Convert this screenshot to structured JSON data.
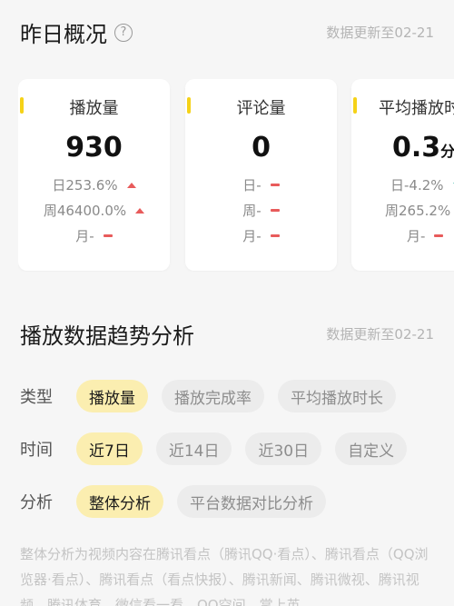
{
  "overview": {
    "title": "昨日概况",
    "help_icon": "?",
    "update_text": "数据更新至02-21",
    "cards": [
      {
        "label": "播放量",
        "value": "930",
        "unit": "",
        "day": "日253.6%",
        "week": "周46400.0%",
        "month": "月-"
      },
      {
        "label": "评论量",
        "value": "0",
        "unit": "",
        "day": "日-",
        "week": "周-",
        "month": "月-"
      },
      {
        "label": "平均播放时长",
        "value": "0.3",
        "unit": "分钟",
        "day": "日-4.2%",
        "week": "周265.2%",
        "month": "月-"
      }
    ]
  },
  "trend": {
    "title": "播放数据趋势分析",
    "update_text": "数据更新至02-21",
    "type_label": "类型",
    "type_options": [
      "播放量",
      "播放完成率",
      "平均播放时长"
    ],
    "time_label": "时间",
    "time_options": [
      "近7日",
      "近14日",
      "近30日",
      "自定义"
    ],
    "analysis_label": "分析",
    "analysis_options": [
      "整体分析",
      "平台数据对比分析"
    ],
    "description": "整体分析为视频内容在腾讯看点（腾讯QQ·看点）、腾讯看点（QQ浏览器·看点）、腾讯看点（看点快报）、腾讯新闻、腾讯微视、腾讯视频、腾讯体育、微信看一看、QQ空间、掌上英"
  },
  "colors": {
    "accent": "#f5d218",
    "up": "#e85b5b",
    "down": "#2fb5a5",
    "chip_active": "#fbeeb0"
  }
}
